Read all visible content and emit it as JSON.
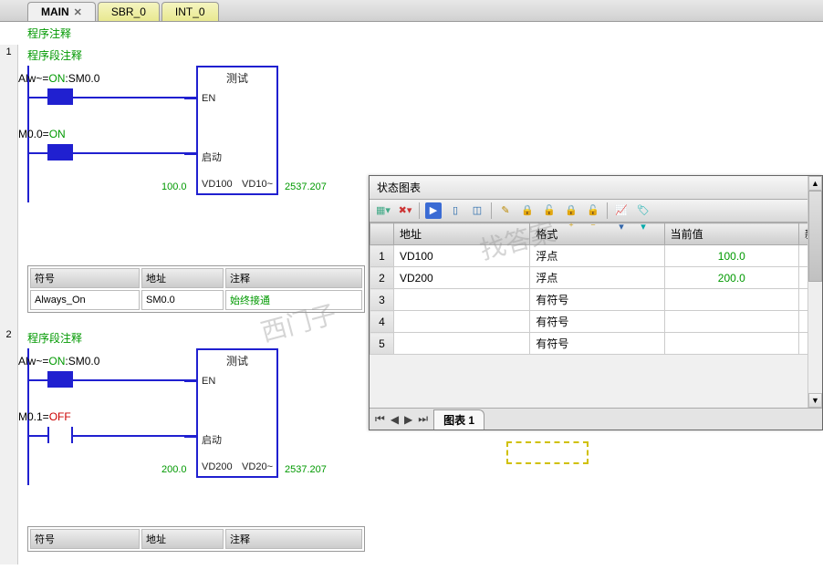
{
  "tabs": {
    "active": "MAIN",
    "t1": "SBR_0",
    "t2": "INT_0"
  },
  "prog_comment": "程序注释",
  "net1": {
    "num": "1",
    "label": "程序段注释",
    "c1_lbl": "Alw~=",
    "c1_on": "ON",
    "c1_addr": ":SM0.0",
    "c2_addr": "M0.0=",
    "c2_on": "ON",
    "fb_title": "测试",
    "en": "EN",
    "start": "启动",
    "in_lbl": "100.0",
    "row_lbl": "VD100",
    "row_lbl2": "VD10~",
    "out_lbl": "2537.207"
  },
  "sym_table": {
    "h1": "符号",
    "h2": "地址",
    "h3": "注释",
    "r1c1": "Always_On",
    "r1c2": "SM0.0",
    "r1c3": "始终接通"
  },
  "net2": {
    "num": "2",
    "label": "程序段注释",
    "c1_lbl": "Alw~=",
    "c1_on": "ON",
    "c1_addr": ":SM0.0",
    "c2_addr": "M0.1=",
    "c2_off": "OFF",
    "fb_title": "测试",
    "en": "EN",
    "start": "启动",
    "in_lbl": "200.0",
    "row_lbl": "VD200",
    "row_lbl2": "VD20~",
    "out_lbl": "2537.207"
  },
  "sym_table2": {
    "h1": "符号",
    "h2": "地址",
    "h3": "注释"
  },
  "status_panel": {
    "title": "状态图表",
    "headers": {
      "addr": "地址",
      "fmt": "格式",
      "val": "当前值",
      "new": "新"
    },
    "rows": [
      {
        "n": "1",
        "addr": "VD100",
        "fmt": "浮点",
        "val": "100.0"
      },
      {
        "n": "2",
        "addr": "VD200",
        "fmt": "浮点",
        "val": "200.0"
      },
      {
        "n": "3",
        "addr": "",
        "fmt": "有符号",
        "val": ""
      },
      {
        "n": "4",
        "addr": "",
        "fmt": "有符号",
        "val": ""
      },
      {
        "n": "5",
        "addr": "",
        "fmt": "有符号",
        "val": ""
      }
    ],
    "chart_tab": "图表 1"
  },
  "watermark1": "找答案",
  "watermark2": "西门子"
}
